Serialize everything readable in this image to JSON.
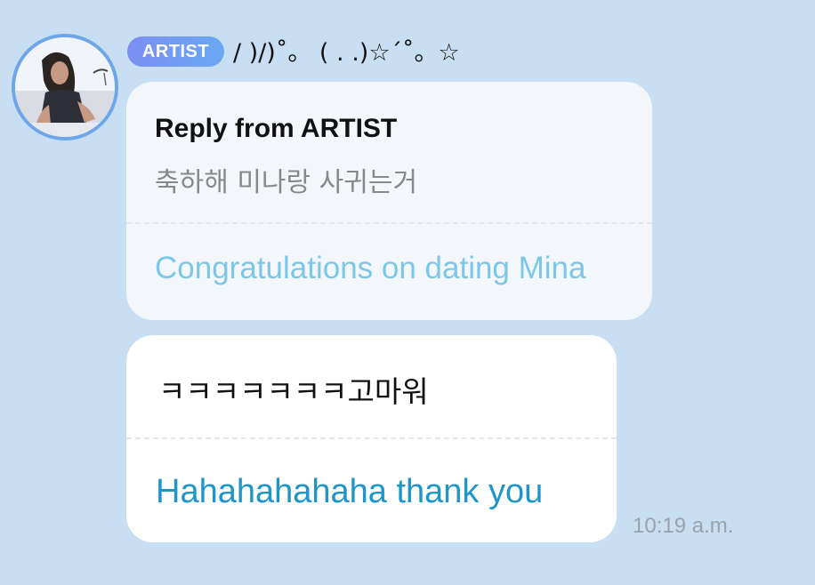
{
  "header": {
    "badge": "ARTIST",
    "artist_name": "/ )/)˚。 ( . .)☆´˚。☆"
  },
  "avatar": {
    "description_icon": "profile-photo"
  },
  "reply": {
    "title": "Reply from ARTIST",
    "original": "축하해 미나랑 사귀는거",
    "translation": "Congratulations on dating Mina"
  },
  "message": {
    "original": "ㅋㅋㅋㅋㅋㅋㅋ고마워",
    "translation": "Hahahahahaha thank you"
  },
  "timestamp": "10:19 a.m.",
  "colors": {
    "background": "#c8def2",
    "badge_gradient_start": "#7b8ef2",
    "badge_gradient_end": "#6aa9f3",
    "reply_translation": "#7cc7e8",
    "message_translation": "#1f95c9"
  }
}
